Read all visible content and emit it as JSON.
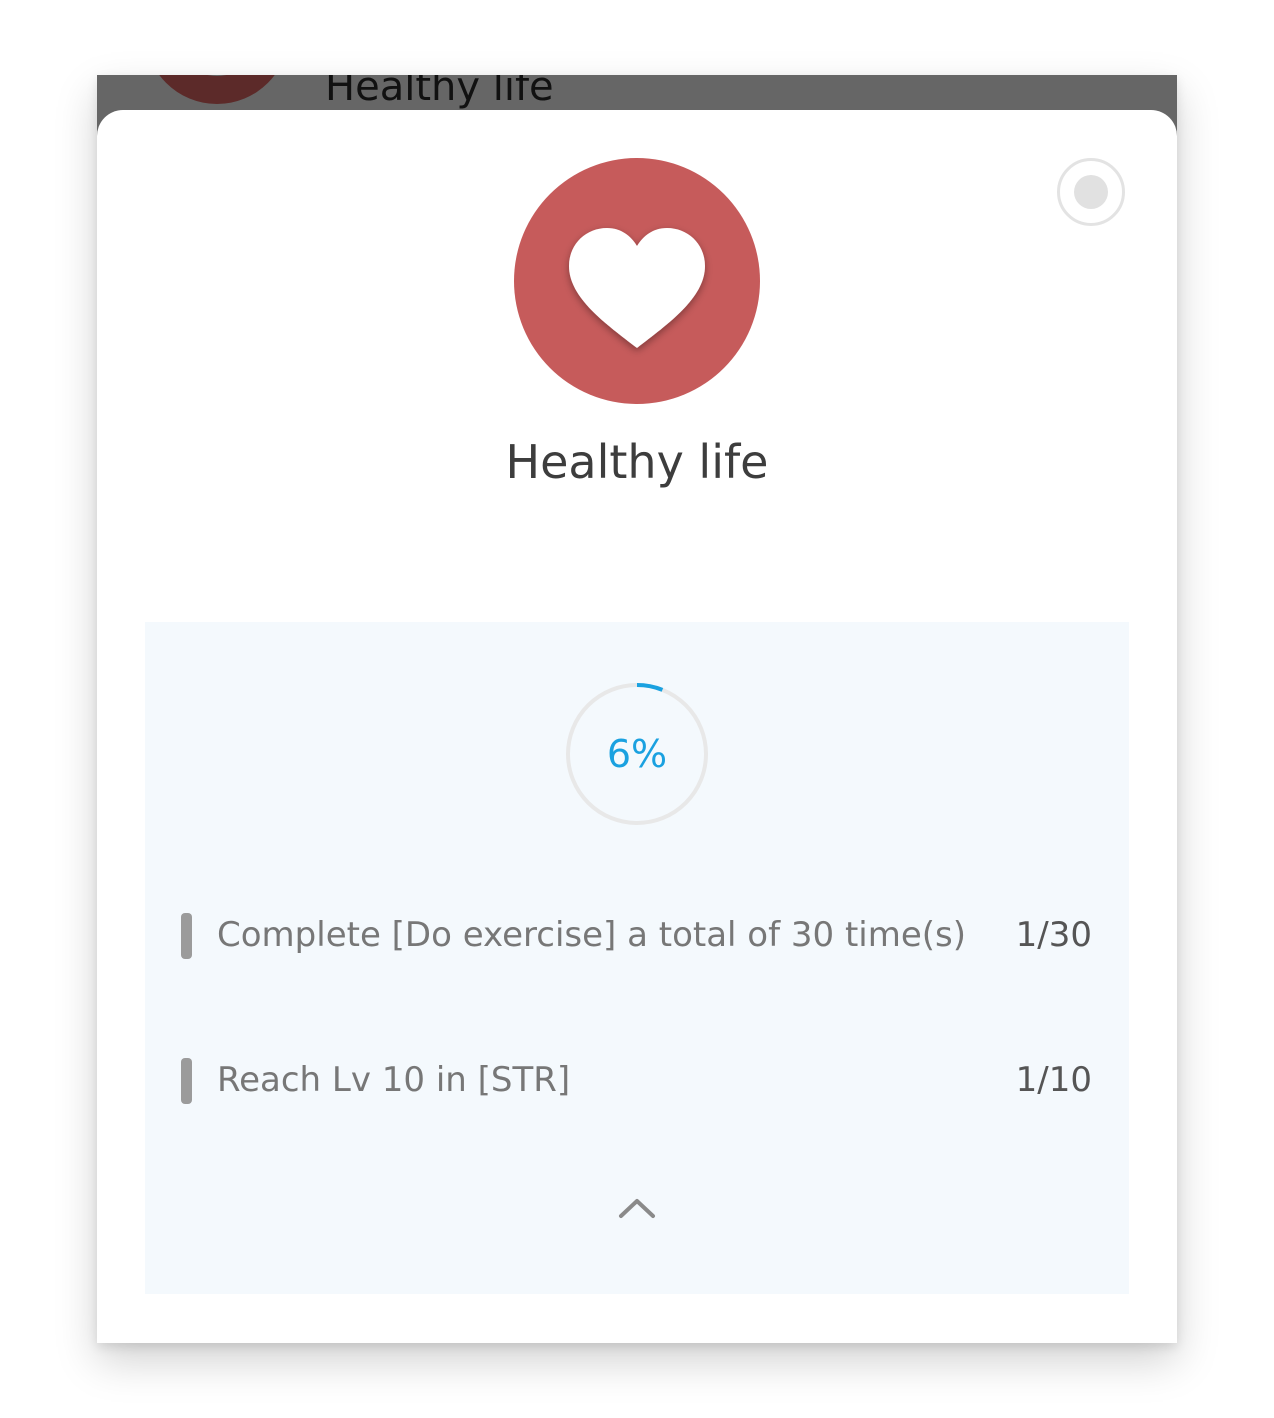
{
  "background": {
    "title": "Healthy life",
    "avatar_color": "#5c2a29"
  },
  "sheet": {
    "select_icon": "radio-button-icon",
    "avatar": {
      "icon": "heart-icon",
      "color": "#c65b5b"
    },
    "title": "Healthy life"
  },
  "progress": {
    "label": "6%",
    "value": 0.06,
    "color": "#1aa1e0"
  },
  "tasks": [
    {
      "text": "Complete [Do exercise] a total of 30 time(s)",
      "count": "1/30"
    },
    {
      "text": "Reach Lv 10 in [STR]",
      "count": "1/10"
    }
  ],
  "collapse_icon": "chevron-up-icon"
}
